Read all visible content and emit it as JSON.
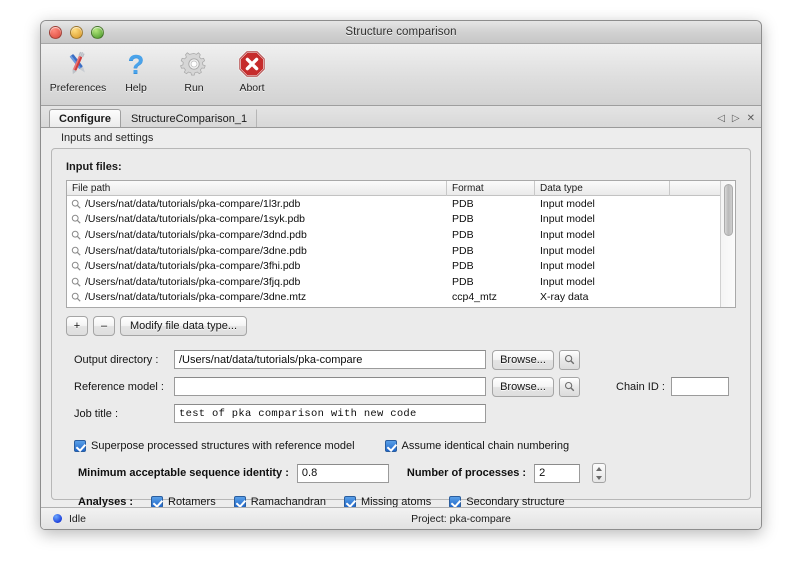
{
  "window": {
    "title": "Structure comparison",
    "traffic_lights": [
      "close-button",
      "minimize-button",
      "maximize-button"
    ]
  },
  "toolbar": {
    "items": [
      {
        "label": "Preferences",
        "icon": "preferences-icon"
      },
      {
        "label": "Help",
        "icon": "help-icon"
      },
      {
        "label": "Run",
        "icon": "run-gear-icon"
      },
      {
        "label": "Abort",
        "icon": "abort-icon"
      }
    ]
  },
  "tabs": {
    "items": [
      {
        "label": "Configure",
        "active": true
      },
      {
        "label": "StructureComparison_1",
        "active": false
      }
    ],
    "controls": [
      "prev-tab-arrow",
      "next-tab-arrow",
      "close-tab-x"
    ]
  },
  "group": {
    "strip_label": "Inputs and settings"
  },
  "main": {
    "input_files_label": "Input files:",
    "table": {
      "columns": [
        "File path",
        "Format",
        "Data type",
        ""
      ],
      "rows": [
        {
          "path": "/Users/nat/data/tutorials/pka-compare/1l3r.pdb",
          "format": "PDB",
          "datatype": "Input model"
        },
        {
          "path": "/Users/nat/data/tutorials/pka-compare/1syk.pdb",
          "format": "PDB",
          "datatype": "Input model"
        },
        {
          "path": "/Users/nat/data/tutorials/pka-compare/3dnd.pdb",
          "format": "PDB",
          "datatype": "Input model"
        },
        {
          "path": "/Users/nat/data/tutorials/pka-compare/3dne.pdb",
          "format": "PDB",
          "datatype": "Input model"
        },
        {
          "path": "/Users/nat/data/tutorials/pka-compare/3fhi.pdb",
          "format": "PDB",
          "datatype": "Input model"
        },
        {
          "path": "/Users/nat/data/tutorials/pka-compare/3fjq.pdb",
          "format": "PDB",
          "datatype": "Input model"
        },
        {
          "path": "/Users/nat/data/tutorials/pka-compare/3dne.mtz",
          "format": "ccp4_mtz",
          "datatype": "X-ray data"
        }
      ]
    },
    "buttons": {
      "add": "+",
      "remove": "–",
      "modify": "Modify file data type..."
    },
    "fields": {
      "output_directory": {
        "label": "Output directory :",
        "value": "/Users/nat/data/tutorials/pka-compare"
      },
      "reference_model": {
        "label": "Reference model :",
        "value": ""
      },
      "job_title": {
        "label": "Job title :",
        "value": "test of pka comparison with new code"
      },
      "chain_id": {
        "label": "Chain ID :",
        "value": ""
      },
      "browse": "Browse..."
    },
    "checkboxes": {
      "superpose": {
        "label": "Superpose processed structures with reference model",
        "checked": true
      },
      "identical_chain": {
        "label": "Assume identical chain numbering",
        "checked": true
      }
    },
    "numeric": {
      "min_seq_identity": {
        "label": "Minimum acceptable sequence identity :",
        "value": "0.8"
      },
      "num_processes": {
        "label": "Number of processes :",
        "value": "2"
      }
    },
    "analyses": {
      "label": "Analyses :",
      "options": [
        {
          "label": "Rotamers",
          "checked": true
        },
        {
          "label": "Ramachandran",
          "checked": true
        },
        {
          "label": "Missing atoms",
          "checked": true
        },
        {
          "label": "Secondary structure",
          "checked": true
        }
      ]
    }
  },
  "status": {
    "state": "Idle",
    "project": "Project: pka-compare",
    "dot_color": "#1433d6"
  }
}
